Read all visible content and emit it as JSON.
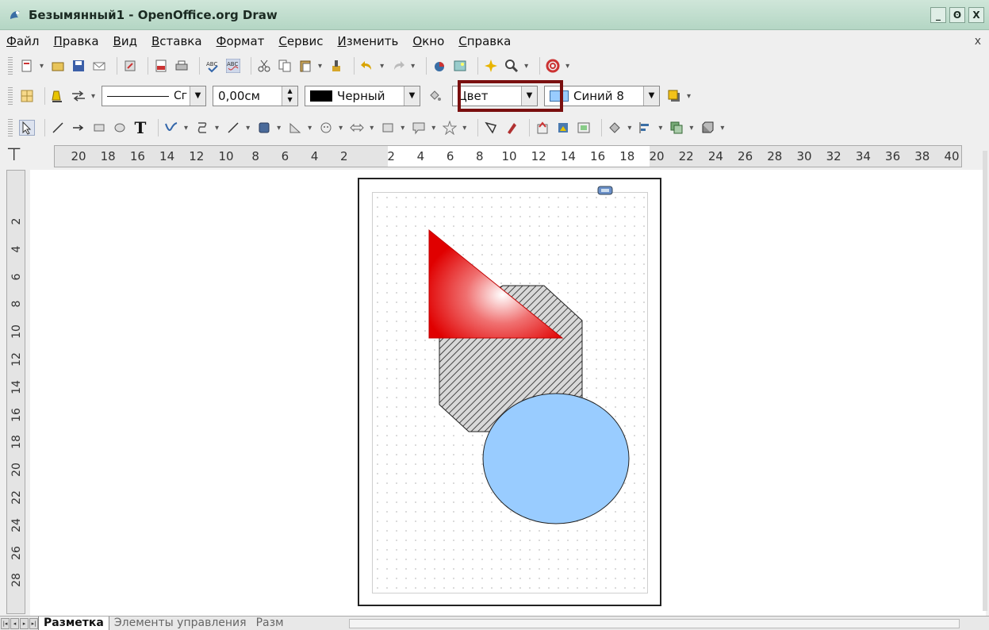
{
  "window": {
    "title": "Безымянный1 - OpenOffice.org Draw",
    "controls": [
      "_",
      "ʘ",
      "X"
    ]
  },
  "menu": [
    "Файл",
    "Правка",
    "Вид",
    "Вставка",
    "Формат",
    "Сервис",
    "Изменить",
    "Окно",
    "Справка"
  ],
  "menu_close": "x",
  "line_toolbar": {
    "line_style_value": "Сг",
    "line_width_value": "0,00см",
    "line_color_value": "Черный",
    "line_color_hex": "#000000",
    "area_style_value": "Цвет",
    "area_color_value": "Синий 8",
    "area_color_hex": "#99ccff"
  },
  "hruler": [
    "20",
    "18",
    "16",
    "14",
    "12",
    "10",
    "8",
    "6",
    "4",
    "2",
    "2",
    "4",
    "6",
    "8",
    "10",
    "12",
    "14",
    "16",
    "18",
    "20",
    "22",
    "24",
    "26",
    "28",
    "30",
    "32",
    "34",
    "36",
    "38",
    "40"
  ],
  "vruler": [
    "2",
    "4",
    "6",
    "8",
    "10",
    "12",
    "14",
    "16",
    "18",
    "20",
    "22",
    "24",
    "26",
    "28"
  ],
  "shapes": {
    "triangle_color": "#e01010",
    "octagon_hatch": "#555555",
    "ellipse_fill": "#99ccff"
  },
  "tabs": {
    "active": "Разметка",
    "second": "Элементы управления",
    "third": "Разм"
  }
}
